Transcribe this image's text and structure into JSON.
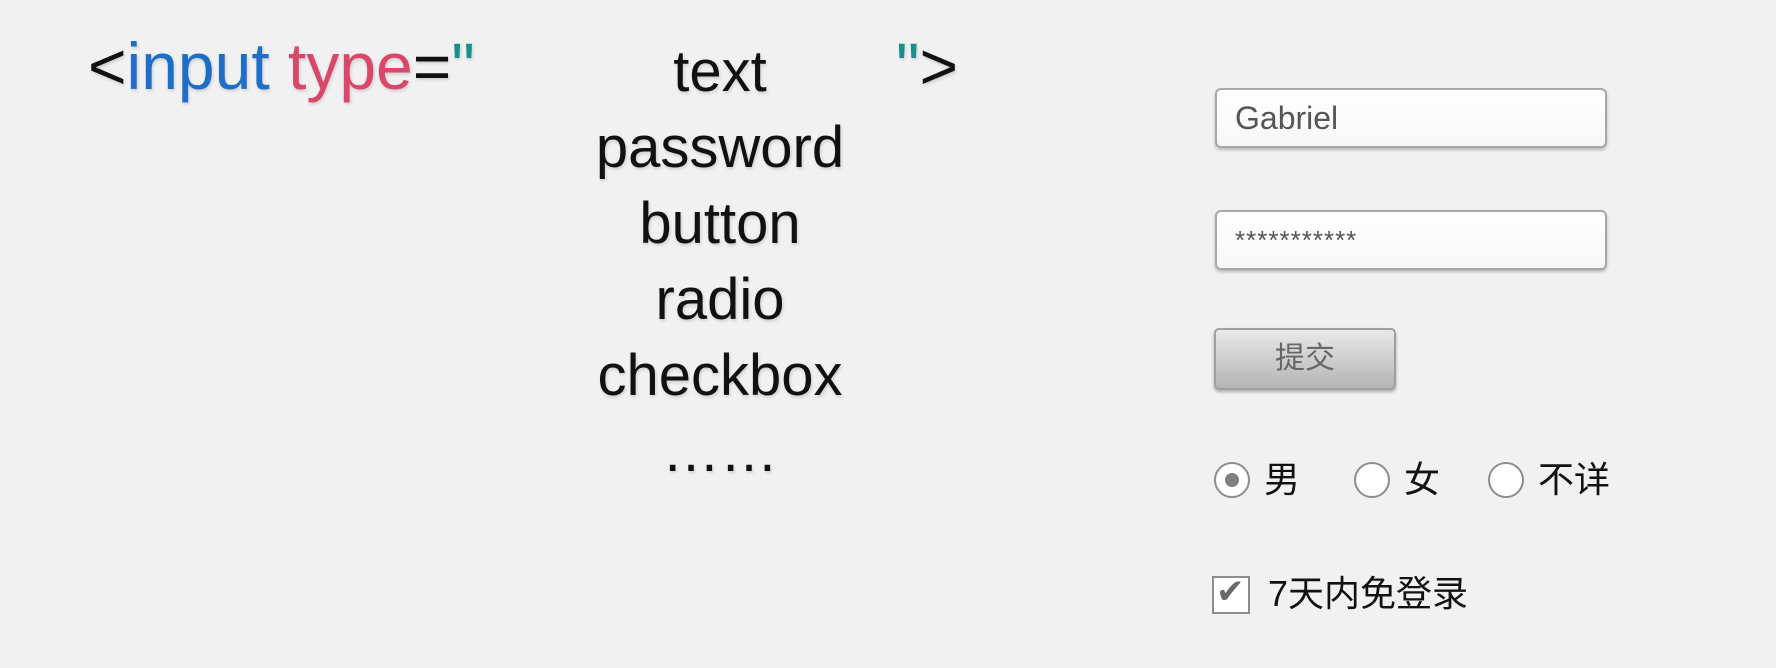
{
  "code": {
    "open_bracket": "<",
    "tag": "input",
    "attr": "type",
    "equals": "=",
    "open_quote": "\"",
    "close_quote": "\"",
    "close_bracket": ">"
  },
  "types": [
    "text",
    "password",
    "button",
    "radio",
    "checkbox",
    "……"
  ],
  "form": {
    "name_value": "Gabriel",
    "password_value": "***********",
    "submit_label": "提交",
    "radios": [
      {
        "label": "男",
        "checked": true
      },
      {
        "label": "女",
        "checked": false
      },
      {
        "label": "不详",
        "checked": false
      }
    ],
    "checkbox_label": "7天内免登录",
    "checkbox_checked": true
  },
  "colors": {
    "tag": "#1e6ec8",
    "attr": "#d9486a",
    "quote": "#17908e"
  }
}
